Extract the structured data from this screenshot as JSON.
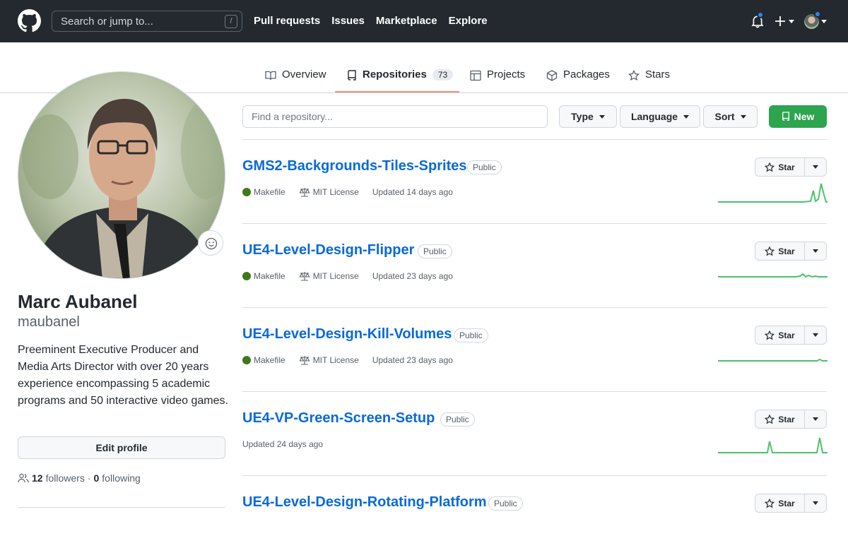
{
  "header": {
    "search_placeholder": "Search or jump to...",
    "search_shortcut": "/",
    "nav": [
      "Pull requests",
      "Issues",
      "Marketplace",
      "Explore"
    ]
  },
  "tabs": [
    {
      "label": "Overview",
      "icon": "book-icon"
    },
    {
      "label": "Repositories",
      "icon": "repo-icon",
      "count": "73",
      "active": true
    },
    {
      "label": "Projects",
      "icon": "table-icon"
    },
    {
      "label": "Packages",
      "icon": "package-icon"
    },
    {
      "label": "Stars",
      "icon": "star-icon"
    }
  ],
  "profile": {
    "name": "Marc Aubanel",
    "login": "maubanel",
    "bio": "Preeminent Executive Producer and Media Arts Director with over 20 years experience encompassing 5 academic programs and 50 interactive video games.",
    "edit_label": "Edit profile",
    "followers_count": "12",
    "followers_label": "followers",
    "separator": "·",
    "following_count": "0",
    "following_label": "following"
  },
  "filters": {
    "find_placeholder": "Find a repository...",
    "type_label": "Type",
    "language_label": "Language",
    "sort_label": "Sort",
    "new_label": "New"
  },
  "repos": [
    {
      "name": "GMS2-Backgrounds-Tiles-Sprites",
      "visibility": "Public",
      "language": "Makefile",
      "license": "MIT License",
      "updated": "Updated 14 days ago",
      "star_label": "Star"
    },
    {
      "name": "UE4-Level-Design-Flipper",
      "visibility": "Public",
      "language": "Makefile",
      "license": "MIT License",
      "updated": "Updated 23 days ago",
      "star_label": "Star"
    },
    {
      "name": "UE4-Level-Design-Kill-Volumes",
      "visibility": "Public",
      "language": "Makefile",
      "license": "MIT License",
      "updated": "Updated 23 days ago",
      "star_label": "Star"
    },
    {
      "name": "UE4-VP-Green-Screen-Setup",
      "visibility": "Public",
      "language": "",
      "license": "",
      "updated": "Updated 24 days ago",
      "star_label": "Star"
    },
    {
      "name": "UE4-Level-Design-Rotating-Platform",
      "visibility": "Public",
      "language": "",
      "license": "",
      "updated": "",
      "star_label": "Star"
    }
  ],
  "colors": {
    "header_bg": "#24292f",
    "link": "#0969da",
    "new_button": "#2da44e",
    "tab_underline": "#fd8c73",
    "makefile_dot": "#427819",
    "sparkline": "#4ac26b"
  }
}
